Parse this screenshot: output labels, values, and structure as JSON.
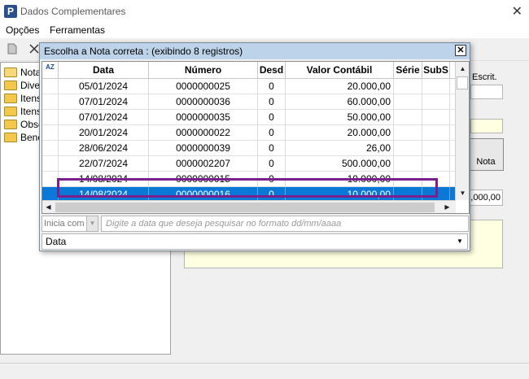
{
  "window": {
    "title": "Dados Complementares",
    "app_icon": "P",
    "close": "✕"
  },
  "menu": [
    "Opções",
    "Ferramentas"
  ],
  "tree": {
    "items": [
      "Nota",
      "Diver",
      "Itens",
      "Itens",
      "Obse",
      "Bene"
    ]
  },
  "background": {
    "escrit_label": "Escrit.",
    "nota_button": "Nota",
    "value_text": ",000,00"
  },
  "dialog": {
    "title": "Escolha a Nota correta : (exibindo 8 registros)",
    "close": "✕",
    "sort_icon_label": "AZ",
    "columns": [
      "Data",
      "Número",
      "Desd",
      "Valor Contábil",
      "Série",
      "SubS"
    ],
    "rows": [
      {
        "data": "05/01/2024",
        "numero": "0000000025",
        "desd": "0",
        "valor": "20.000,00",
        "serie": "",
        "subs": ""
      },
      {
        "data": "07/01/2024",
        "numero": "0000000036",
        "desd": "0",
        "valor": "60.000,00",
        "serie": "",
        "subs": ""
      },
      {
        "data": "07/01/2024",
        "numero": "0000000035",
        "desd": "0",
        "valor": "50.000,00",
        "serie": "",
        "subs": ""
      },
      {
        "data": "20/01/2024",
        "numero": "0000000022",
        "desd": "0",
        "valor": "20.000,00",
        "serie": "",
        "subs": ""
      },
      {
        "data": "28/06/2024",
        "numero": "0000000039",
        "desd": "0",
        "valor": "26,00",
        "serie": "",
        "subs": ""
      },
      {
        "data": "22/07/2024",
        "numero": "0000002207",
        "desd": "0",
        "valor": "500.000,00",
        "serie": "",
        "subs": ""
      },
      {
        "data": "14/08/2024",
        "numero": "0000000015",
        "desd": "0",
        "valor": "10.000,00",
        "serie": "",
        "subs": ""
      },
      {
        "data": "14/08/2024",
        "numero": "0000000016",
        "desd": "0",
        "valor": "10.000,00",
        "serie": "",
        "subs": ""
      }
    ],
    "selected_row": 7,
    "search_mode": "Inicia com",
    "search_placeholder": "Digite a data que deseja pesquisar no formato dd/mm/aaaa",
    "field": "Data"
  },
  "colors": {
    "selection": "#0a78d7",
    "highlight_box": "#7b1f8f",
    "dialog_title_bg": "#bcd3ea"
  }
}
